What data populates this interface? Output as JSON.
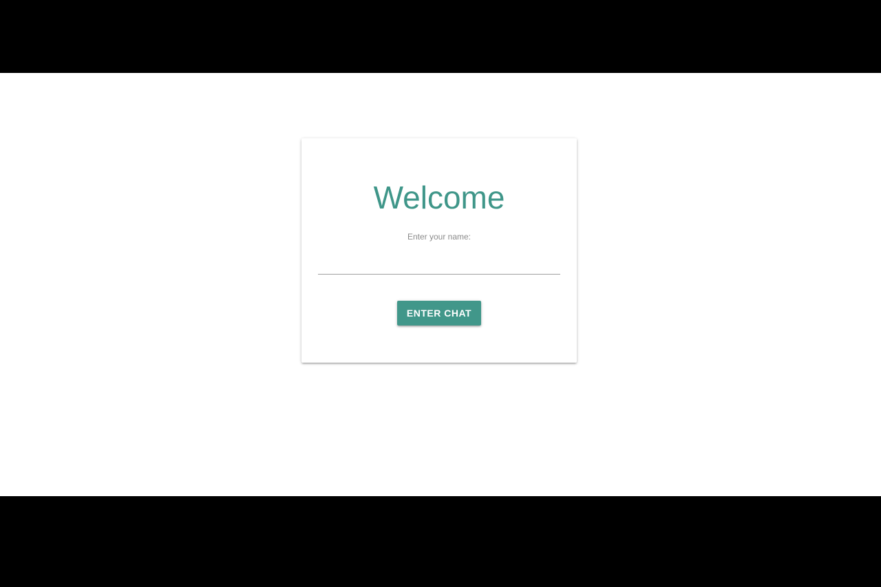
{
  "colors": {
    "accent": "#41978a",
    "title": "#3f9689",
    "label": "#8a8a8a",
    "background": "#ffffff",
    "letterbox": "#000000"
  },
  "login_card": {
    "title": "Welcome",
    "name_label": "Enter your name:",
    "name_input": {
      "value": "",
      "placeholder": ""
    },
    "enter_button_label": "Enter Chat"
  }
}
